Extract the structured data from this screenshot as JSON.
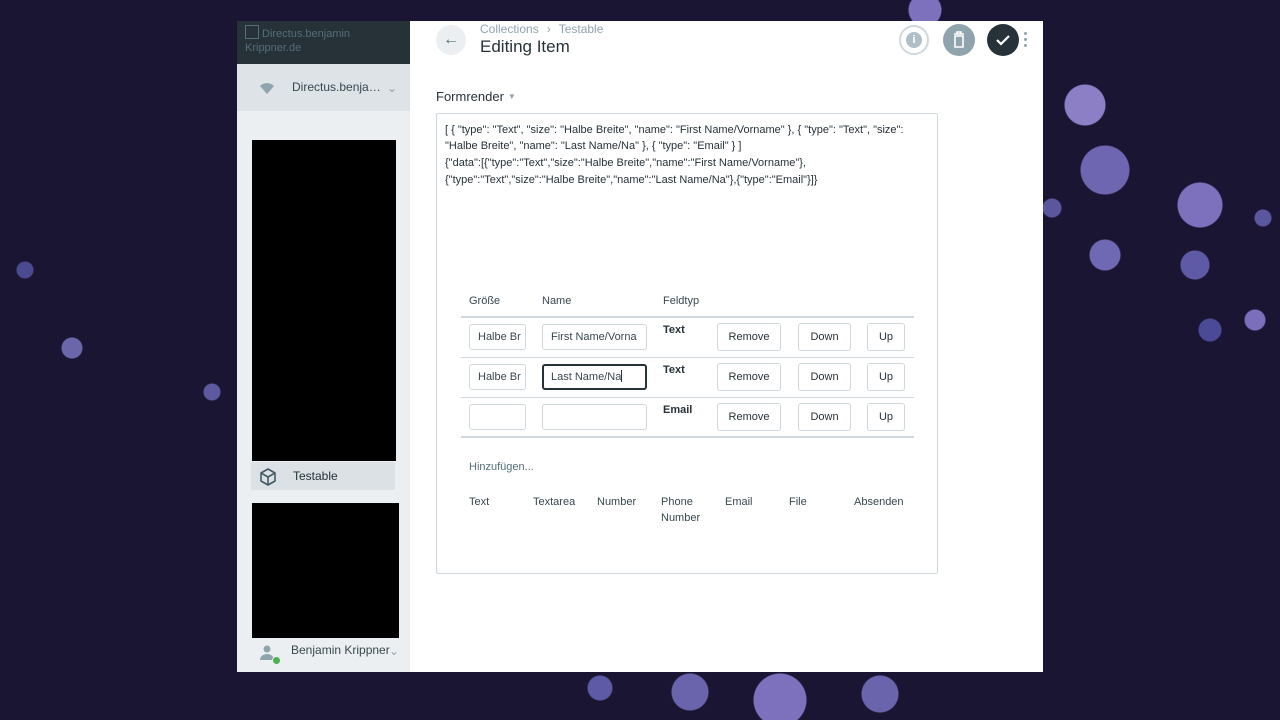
{
  "sidebar": {
    "logo_alt": "Directus.benjamin Krippner.de",
    "project_name": "Directus.benja…",
    "nav_item_label": "Testable",
    "user_name": "Benjamin Krippner"
  },
  "header": {
    "breadcrumb": [
      "Collections",
      "Testable"
    ],
    "title": "Editing Item",
    "info_label": "i"
  },
  "field": {
    "label": "Formrender",
    "json_lines": [
      "[ { \"type\": \"Text\", \"size\": \"Halbe Breite\", \"name\": \"First Name/Vorname\" }, { \"type\": \"Text\", \"size\":",
      "\"Halbe Breite\", \"name\": \"Last Name/Na\" }, { \"type\": \"Email\" } ]",
      "{\"data\":[{\"type\":\"Text\",\"size\":\"Halbe Breite\",\"name\":\"First Name/Vorname\"},",
      "{\"type\":\"Text\",\"size\":\"Halbe Breite\",\"name\":\"Last Name/Na\"},{\"type\":\"Email\"}]}"
    ],
    "columns": {
      "size": "Größe",
      "name": "Name",
      "type": "Feldtyp"
    },
    "rows": [
      {
        "size": "Halbe Br",
        "name": "First Name/Vorna",
        "type": "Text"
      },
      {
        "size": "Halbe Br",
        "name": "Last Name/Na",
        "type": "Text"
      },
      {
        "size": "",
        "name": "",
        "type": "Email"
      }
    ],
    "buttons": {
      "remove": "Remove",
      "down": "Down",
      "up": "Up"
    },
    "add_label": "Hinzufügen...",
    "add_options": [
      "Text",
      "Textarea",
      "Number",
      "Phone Number",
      "Email",
      "File",
      "Absenden"
    ]
  }
}
